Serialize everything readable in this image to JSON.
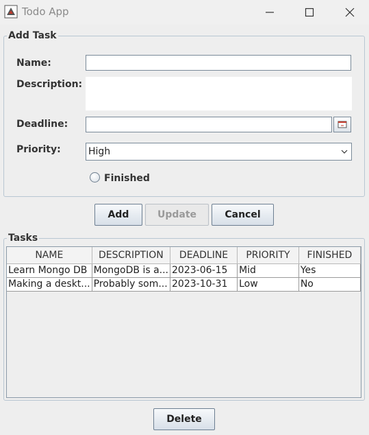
{
  "window": {
    "title": "Todo App",
    "icon": "java-cup-icon",
    "controls": [
      "minimize-icon",
      "maximize-icon",
      "close-icon"
    ]
  },
  "add_task": {
    "legend": "Add Task",
    "name_label": "Name:",
    "name_value": "",
    "description_label": "Description:",
    "description_value": "",
    "deadline_label": "Deadline:",
    "deadline_value": "",
    "priority_label": "Priority:",
    "priority_value": "High",
    "finished_label": "Finished",
    "finished_checked": false
  },
  "buttons": {
    "add": "Add",
    "update": "Update",
    "cancel": "Cancel",
    "delete": "Delete"
  },
  "tasks": {
    "legend": "Tasks",
    "columns": [
      "NAME",
      "DESCRIPTION",
      "DEADLINE",
      "PRIORITY",
      "FINISHED"
    ],
    "rows": [
      [
        "Learn Mongo DB",
        "MongoDB is a...",
        "2023-06-15",
        "Mid",
        "Yes"
      ],
      [
        "Making a deskt...",
        "Probably som...",
        "2023-10-31",
        "Low",
        "No"
      ]
    ]
  }
}
